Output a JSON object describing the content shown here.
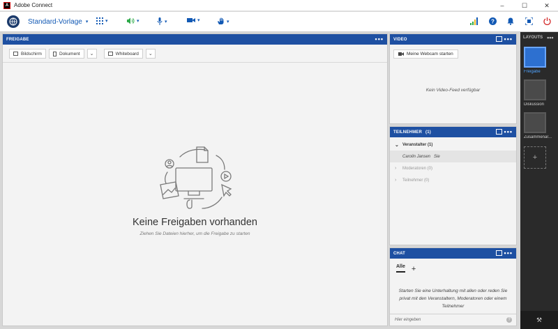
{
  "window": {
    "title": "Adobe Connect",
    "logo_glyph": "A",
    "controls": [
      "–",
      "☐",
      "✕"
    ]
  },
  "toolbar": {
    "template_name": "Standard-Vorlage",
    "icons": [
      "apps-icon",
      "speaker-icon",
      "microphone-icon",
      "camera-icon",
      "raise-hand-icon"
    ],
    "right_icons": [
      "network-icon",
      "help-icon",
      "notifications-icon",
      "fullscreen-icon",
      "power-icon"
    ],
    "colors": {
      "accent": "#1259b4",
      "speaker": "#2eaa4a",
      "power": "#d42a2a"
    }
  },
  "share_pod": {
    "header": "FREIGABE",
    "tools": {
      "screen": "Bildschirm",
      "document": "Dokument",
      "whiteboard": "Whiteboard"
    },
    "empty_title": "Keine Freigaben vorhanden",
    "empty_subtitle": "Ziehen Sie Dateien hierher, um die Freigabe zu starten"
  },
  "video_pod": {
    "header": "VIDEO",
    "webcam_button": "Meine Webcam starten",
    "no_feed": "Kein Video-Feed verfügbar"
  },
  "participants_pod": {
    "header": "TEILNEHMER",
    "count": "(1)",
    "groups": [
      {
        "label": "Veranstalter (1)",
        "expanded": true,
        "members": [
          {
            "name": "Carolin Jansen",
            "suffix": "Sie"
          }
        ]
      },
      {
        "label": "Moderatoren (0)",
        "expanded": false,
        "members": []
      },
      {
        "label": "Teilnehmer (0)",
        "expanded": false,
        "members": []
      }
    ]
  },
  "chat_pod": {
    "header": "CHAT",
    "tab_all": "Alle",
    "tab_add": "+",
    "info": "Starten Sie eine Unterhaltung mit allen oder reden Sie privat mit den Veranstaltern, Moderatoren oder einem Teilnehmer",
    "input_placeholder": "Hier eingeben",
    "send_glyph": "?"
  },
  "layouts": {
    "header": "LAYOUTS",
    "items": [
      {
        "label": "Freigabe",
        "active": true
      },
      {
        "label": "Diskussion",
        "active": false
      },
      {
        "label": "Zusammenar...",
        "active": false
      }
    ],
    "add": "+"
  }
}
